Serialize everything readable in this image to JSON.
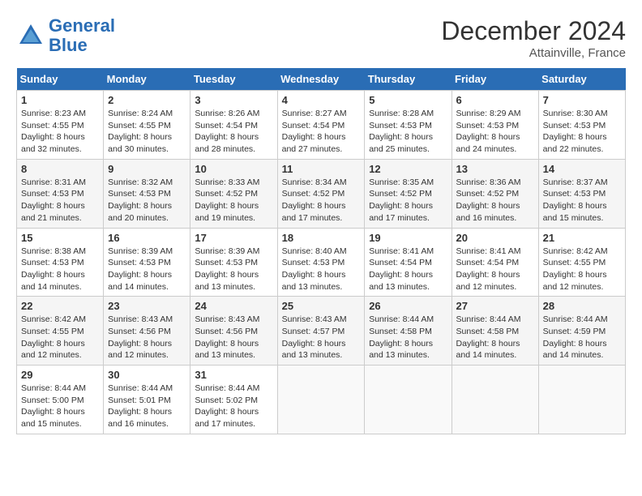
{
  "header": {
    "logo_line1": "General",
    "logo_line2": "Blue",
    "month_year": "December 2024",
    "location": "Attainville, France"
  },
  "weekdays": [
    "Sunday",
    "Monday",
    "Tuesday",
    "Wednesday",
    "Thursday",
    "Friday",
    "Saturday"
  ],
  "weeks": [
    [
      {
        "day": "1",
        "sunrise": "8:23 AM",
        "sunset": "4:55 PM",
        "daylight": "8 hours and 32 minutes"
      },
      {
        "day": "2",
        "sunrise": "8:24 AM",
        "sunset": "4:55 PM",
        "daylight": "8 hours and 30 minutes"
      },
      {
        "day": "3",
        "sunrise": "8:26 AM",
        "sunset": "4:54 PM",
        "daylight": "8 hours and 28 minutes"
      },
      {
        "day": "4",
        "sunrise": "8:27 AM",
        "sunset": "4:54 PM",
        "daylight": "8 hours and 27 minutes"
      },
      {
        "day": "5",
        "sunrise": "8:28 AM",
        "sunset": "4:53 PM",
        "daylight": "8 hours and 25 minutes"
      },
      {
        "day": "6",
        "sunrise": "8:29 AM",
        "sunset": "4:53 PM",
        "daylight": "8 hours and 24 minutes"
      },
      {
        "day": "7",
        "sunrise": "8:30 AM",
        "sunset": "4:53 PM",
        "daylight": "8 hours and 22 minutes"
      }
    ],
    [
      {
        "day": "8",
        "sunrise": "8:31 AM",
        "sunset": "4:53 PM",
        "daylight": "8 hours and 21 minutes"
      },
      {
        "day": "9",
        "sunrise": "8:32 AM",
        "sunset": "4:53 PM",
        "daylight": "8 hours and 20 minutes"
      },
      {
        "day": "10",
        "sunrise": "8:33 AM",
        "sunset": "4:52 PM",
        "daylight": "8 hours and 19 minutes"
      },
      {
        "day": "11",
        "sunrise": "8:34 AM",
        "sunset": "4:52 PM",
        "daylight": "8 hours and 17 minutes"
      },
      {
        "day": "12",
        "sunrise": "8:35 AM",
        "sunset": "4:52 PM",
        "daylight": "8 hours and 17 minutes"
      },
      {
        "day": "13",
        "sunrise": "8:36 AM",
        "sunset": "4:52 PM",
        "daylight": "8 hours and 16 minutes"
      },
      {
        "day": "14",
        "sunrise": "8:37 AM",
        "sunset": "4:53 PM",
        "daylight": "8 hours and 15 minutes"
      }
    ],
    [
      {
        "day": "15",
        "sunrise": "8:38 AM",
        "sunset": "4:53 PM",
        "daylight": "8 hours and 14 minutes"
      },
      {
        "day": "16",
        "sunrise": "8:39 AM",
        "sunset": "4:53 PM",
        "daylight": "8 hours and 14 minutes"
      },
      {
        "day": "17",
        "sunrise": "8:39 AM",
        "sunset": "4:53 PM",
        "daylight": "8 hours and 13 minutes"
      },
      {
        "day": "18",
        "sunrise": "8:40 AM",
        "sunset": "4:53 PM",
        "daylight": "8 hours and 13 minutes"
      },
      {
        "day": "19",
        "sunrise": "8:41 AM",
        "sunset": "4:54 PM",
        "daylight": "8 hours and 13 minutes"
      },
      {
        "day": "20",
        "sunrise": "8:41 AM",
        "sunset": "4:54 PM",
        "daylight": "8 hours and 12 minutes"
      },
      {
        "day": "21",
        "sunrise": "8:42 AM",
        "sunset": "4:55 PM",
        "daylight": "8 hours and 12 minutes"
      }
    ],
    [
      {
        "day": "22",
        "sunrise": "8:42 AM",
        "sunset": "4:55 PM",
        "daylight": "8 hours and 12 minutes"
      },
      {
        "day": "23",
        "sunrise": "8:43 AM",
        "sunset": "4:56 PM",
        "daylight": "8 hours and 12 minutes"
      },
      {
        "day": "24",
        "sunrise": "8:43 AM",
        "sunset": "4:56 PM",
        "daylight": "8 hours and 13 minutes"
      },
      {
        "day": "25",
        "sunrise": "8:43 AM",
        "sunset": "4:57 PM",
        "daylight": "8 hours and 13 minutes"
      },
      {
        "day": "26",
        "sunrise": "8:44 AM",
        "sunset": "4:58 PM",
        "daylight": "8 hours and 13 minutes"
      },
      {
        "day": "27",
        "sunrise": "8:44 AM",
        "sunset": "4:58 PM",
        "daylight": "8 hours and 14 minutes"
      },
      {
        "day": "28",
        "sunrise": "8:44 AM",
        "sunset": "4:59 PM",
        "daylight": "8 hours and 14 minutes"
      }
    ],
    [
      {
        "day": "29",
        "sunrise": "8:44 AM",
        "sunset": "5:00 PM",
        "daylight": "8 hours and 15 minutes"
      },
      {
        "day": "30",
        "sunrise": "8:44 AM",
        "sunset": "5:01 PM",
        "daylight": "8 hours and 16 minutes"
      },
      {
        "day": "31",
        "sunrise": "8:44 AM",
        "sunset": "5:02 PM",
        "daylight": "8 hours and 17 minutes"
      },
      null,
      null,
      null,
      null
    ]
  ]
}
